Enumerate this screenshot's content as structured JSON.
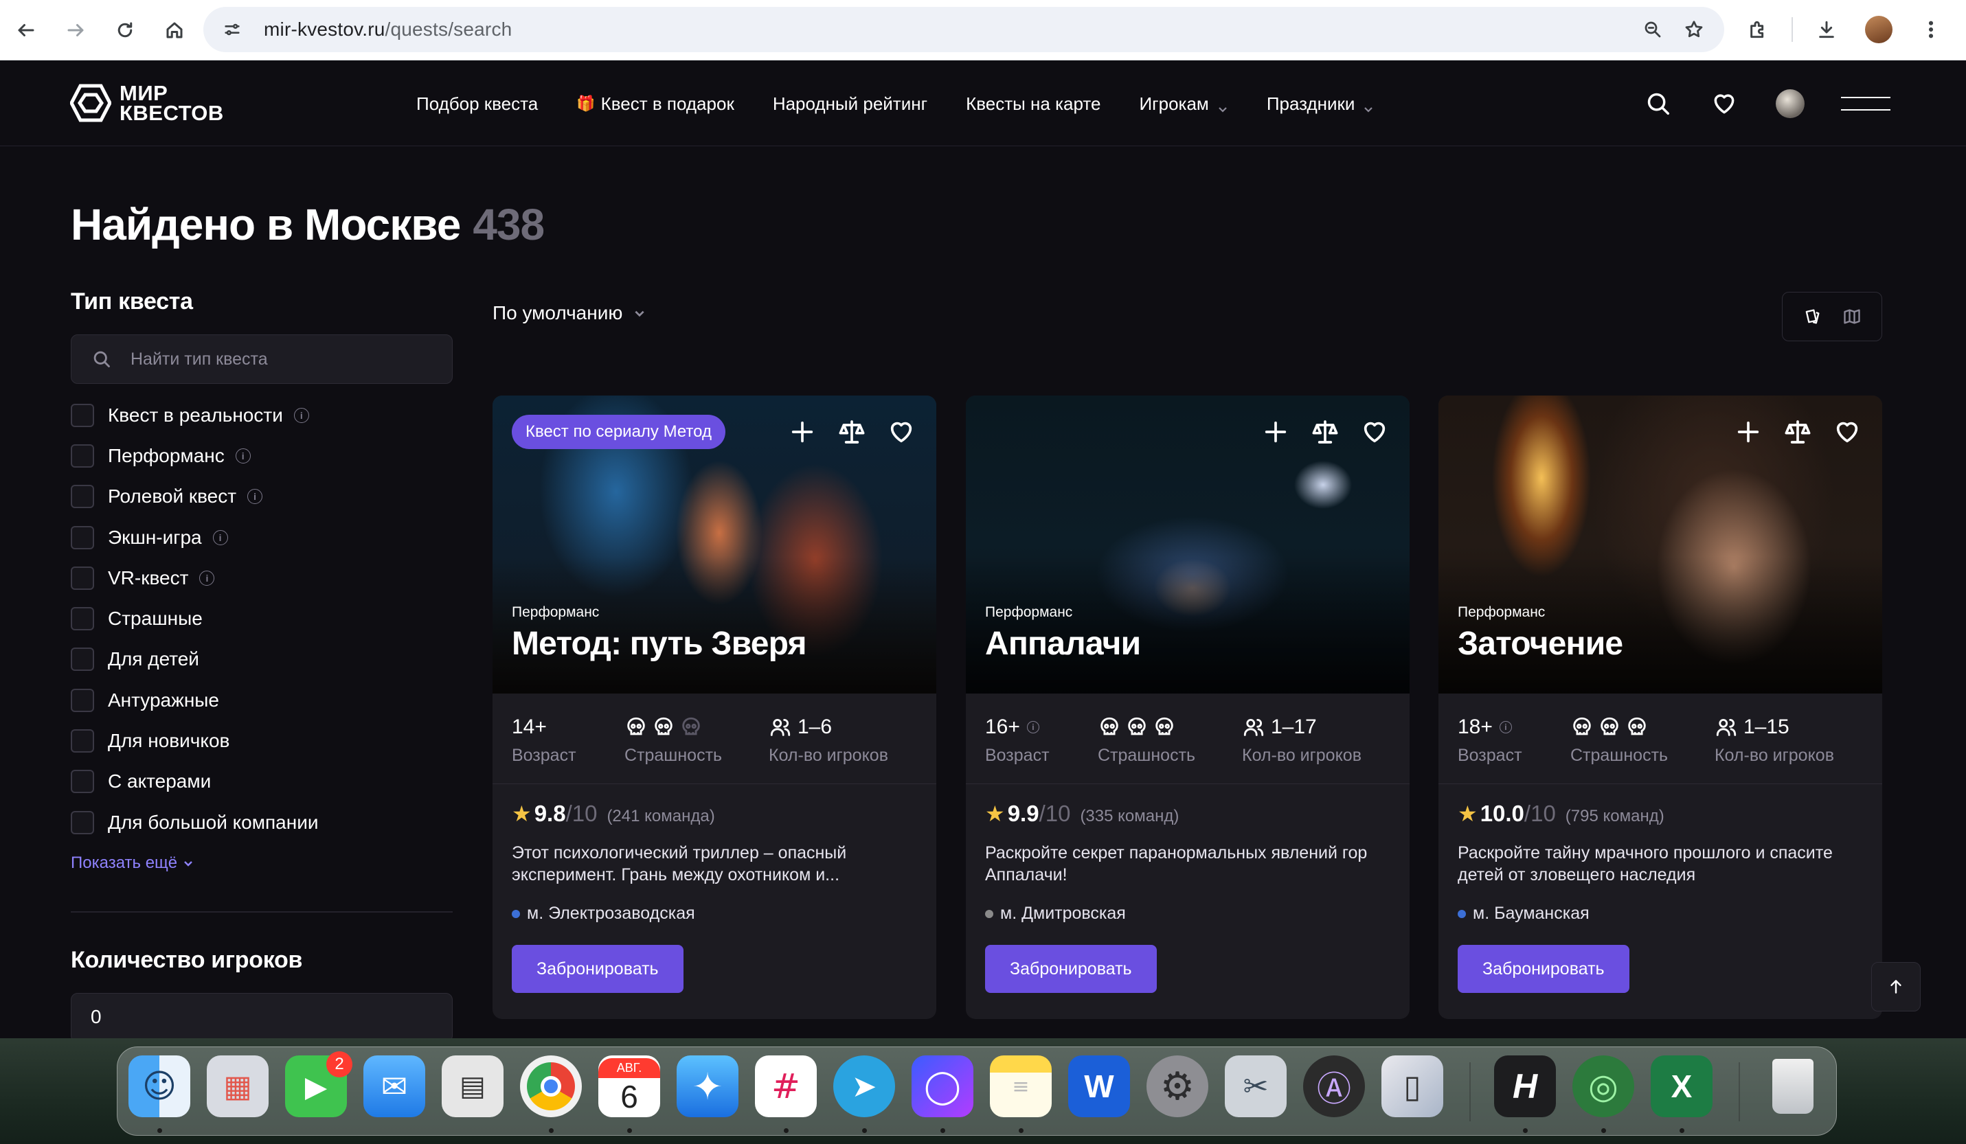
{
  "browser": {
    "url_domain": "mir-kvestov.ru",
    "url_path": "/quests/search"
  },
  "header": {
    "logo_line1": "МИР",
    "logo_line2": "КВЕСТОВ",
    "nav": [
      {
        "label": "Подбор квеста"
      },
      {
        "label": "Квест в подарок"
      },
      {
        "label": "Народный рейтинг"
      },
      {
        "label": "Квесты на карте"
      },
      {
        "label": "Игрокам"
      },
      {
        "label": "Праздники"
      }
    ]
  },
  "page": {
    "title": "Найдено в Москве",
    "count": "438",
    "sort_label": "По умолчанию"
  },
  "sidebar": {
    "quest_type_title": "Тип квеста",
    "search_placeholder": "Найти тип квеста",
    "filters": [
      {
        "label": "Квест в реальности",
        "info": "i"
      },
      {
        "label": "Перформанс",
        "info": "i"
      },
      {
        "label": "Ролевой квест",
        "info": "i"
      },
      {
        "label": "Экшн-игра",
        "info": "i"
      },
      {
        "label": "VR-квест",
        "info": "i"
      },
      {
        "label": "Страшные"
      },
      {
        "label": "Для детей"
      },
      {
        "label": "Антуражные"
      },
      {
        "label": "Для новичков"
      },
      {
        "label": "С актерами"
      },
      {
        "label": "Для большой компании"
      }
    ],
    "show_more": "Показать ещё",
    "players_title": "Количество игроков",
    "players_value": "0"
  },
  "stat_labels": {
    "age": "Возраст",
    "fear": "Страшность",
    "players": "Кол-во игроков"
  },
  "cards": [
    {
      "badge": "Квест по сериалу Метод",
      "type": "Перформанс",
      "title": "Метод: путь Зверя",
      "age": "14+",
      "fear_level": 2,
      "fear_max": 3,
      "players": "1–6",
      "rating": "9.8",
      "rating_max": "/10",
      "teams": "(241 команда)",
      "description": "Этот психологический триллер – опасный эксперимент. Грань между охотником и...",
      "metro": "м. Электрозаводская",
      "metro_color": "#3c6fd6",
      "button": "Забронировать"
    },
    {
      "type": "Перформанс",
      "title": "Аппалачи",
      "age": "16+",
      "age_info": "i",
      "fear_level": 3,
      "fear_max": 3,
      "players": "1–17",
      "rating": "9.9",
      "rating_max": "/10",
      "teams": "(335 команд)",
      "description": "Раскройте секрет паранормальных явлений гор Аппалачи!",
      "metro": "м. Дмитровская",
      "metro_color": "#8a8a8a",
      "button": "Забронировать"
    },
    {
      "type": "Перформанс",
      "title": "Заточение",
      "age": "18+",
      "age_info": "i",
      "fear_level": 3,
      "fear_max": 3,
      "players": "1–15",
      "rating": "10.0",
      "rating_max": "/10",
      "teams": "(795 команд)",
      "description": "Раскройте тайну мрачного прошлого и спасите детей от зловещего наследия",
      "metro": "м. Бауманская",
      "metro_color": "#3c6fd6",
      "button": "Забронировать"
    }
  ],
  "colors": {
    "accent": "#6a4fe0",
    "link": "#8f82ff",
    "background": "#0e0d12",
    "card": "#1c1b21",
    "star": "#f5c444"
  },
  "dock": {
    "facetime_badge": "2",
    "calendar_month": "АВГ.",
    "calendar_day": "6"
  }
}
